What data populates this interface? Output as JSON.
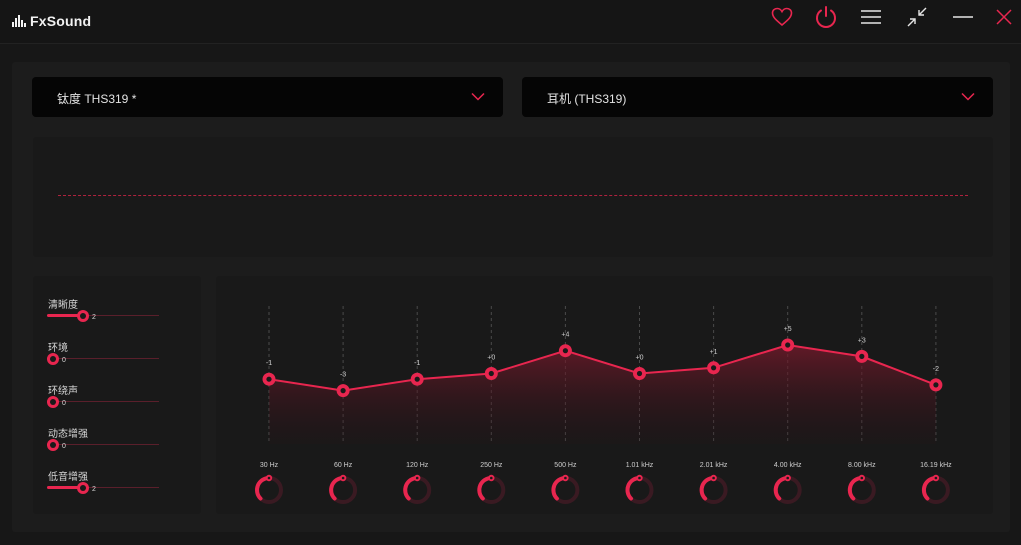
{
  "app": {
    "name": "FxSound"
  },
  "colors": {
    "accent": "#e8264f",
    "background": "#171717",
    "panel": "#191919",
    "dropdown": "#050505"
  },
  "titlebar": {
    "buttons": [
      {
        "name": "favorite",
        "icon": "heart-icon"
      },
      {
        "name": "power",
        "icon": "power-icon"
      },
      {
        "name": "menu",
        "icon": "menu-icon"
      },
      {
        "name": "minimize-view",
        "icon": "compress-icon"
      },
      {
        "name": "minimize",
        "icon": "minimize-icon"
      },
      {
        "name": "close",
        "icon": "close-icon"
      }
    ]
  },
  "preset_dropdown": {
    "value": "钛度 THS319 *",
    "icon": "chevron-down-icon"
  },
  "output_dropdown": {
    "value": "耳机 (THS319)",
    "icon": "chevron-down-icon"
  },
  "effects": [
    {
      "label": "清晰度",
      "value": "2",
      "level": 2,
      "max": 10
    },
    {
      "label": "环境",
      "value": "0",
      "level": 0,
      "max": 10
    },
    {
      "label": "环绕声",
      "value": "0",
      "level": 0,
      "max": 10
    },
    {
      "label": "动态增强",
      "value": "0",
      "level": 0,
      "max": 10
    },
    {
      "label": "低音增强",
      "value": "2",
      "level": 2,
      "max": 10
    }
  ],
  "equalizer": {
    "range": [
      -12,
      12
    ],
    "bands": [
      {
        "freq": "30 Hz",
        "gain": -1,
        "gain_label": "-1"
      },
      {
        "freq": "60 Hz",
        "gain": -3,
        "gain_label": "-3"
      },
      {
        "freq": "120 Hz",
        "gain": -1,
        "gain_label": "-1"
      },
      {
        "freq": "250 Hz",
        "gain": 0,
        "gain_label": "+0"
      },
      {
        "freq": "500 Hz",
        "gain": 4,
        "gain_label": "+4"
      },
      {
        "freq": "1.01 kHz",
        "gain": 0,
        "gain_label": "+0"
      },
      {
        "freq": "2.01 kHz",
        "gain": 1,
        "gain_label": "+1"
      },
      {
        "freq": "4.00 kHz",
        "gain": 5,
        "gain_label": "+5"
      },
      {
        "freq": "8.00 kHz",
        "gain": 3,
        "gain_label": "+3"
      },
      {
        "freq": "16.19 kHz",
        "gain": -2,
        "gain_label": "-2"
      }
    ]
  }
}
